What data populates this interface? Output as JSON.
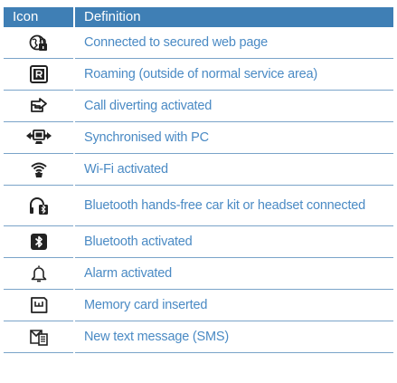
{
  "table": {
    "header": {
      "icon": "Icon",
      "definition": "Definition"
    },
    "rows": [
      {
        "icon": "secured-web-page-icon",
        "definition": "Connected to secured web page"
      },
      {
        "icon": "roaming-icon",
        "definition": "Roaming (outside of normal service area)"
      },
      {
        "icon": "call-divert-icon",
        "definition": "Call diverting activated"
      },
      {
        "icon": "pc-sync-icon",
        "definition": "Synchronised with PC"
      },
      {
        "icon": "wifi-icon",
        "definition": "Wi-Fi activated"
      },
      {
        "icon": "bluetooth-headset-icon",
        "definition": "Bluetooth hands-free car kit or headset connected"
      },
      {
        "icon": "bluetooth-icon",
        "definition": "Bluetooth activated"
      },
      {
        "icon": "alarm-bell-icon",
        "definition": "Alarm activated"
      },
      {
        "icon": "memory-card-icon",
        "definition": "Memory card inserted"
      },
      {
        "icon": "sms-message-icon",
        "definition": "New text message (SMS)"
      }
    ]
  },
  "colors": {
    "header_bg": "#3f7fb5",
    "header_text": "#ffffff",
    "body_text": "#4a8ac4",
    "row_divider": "#7aa4c9"
  }
}
